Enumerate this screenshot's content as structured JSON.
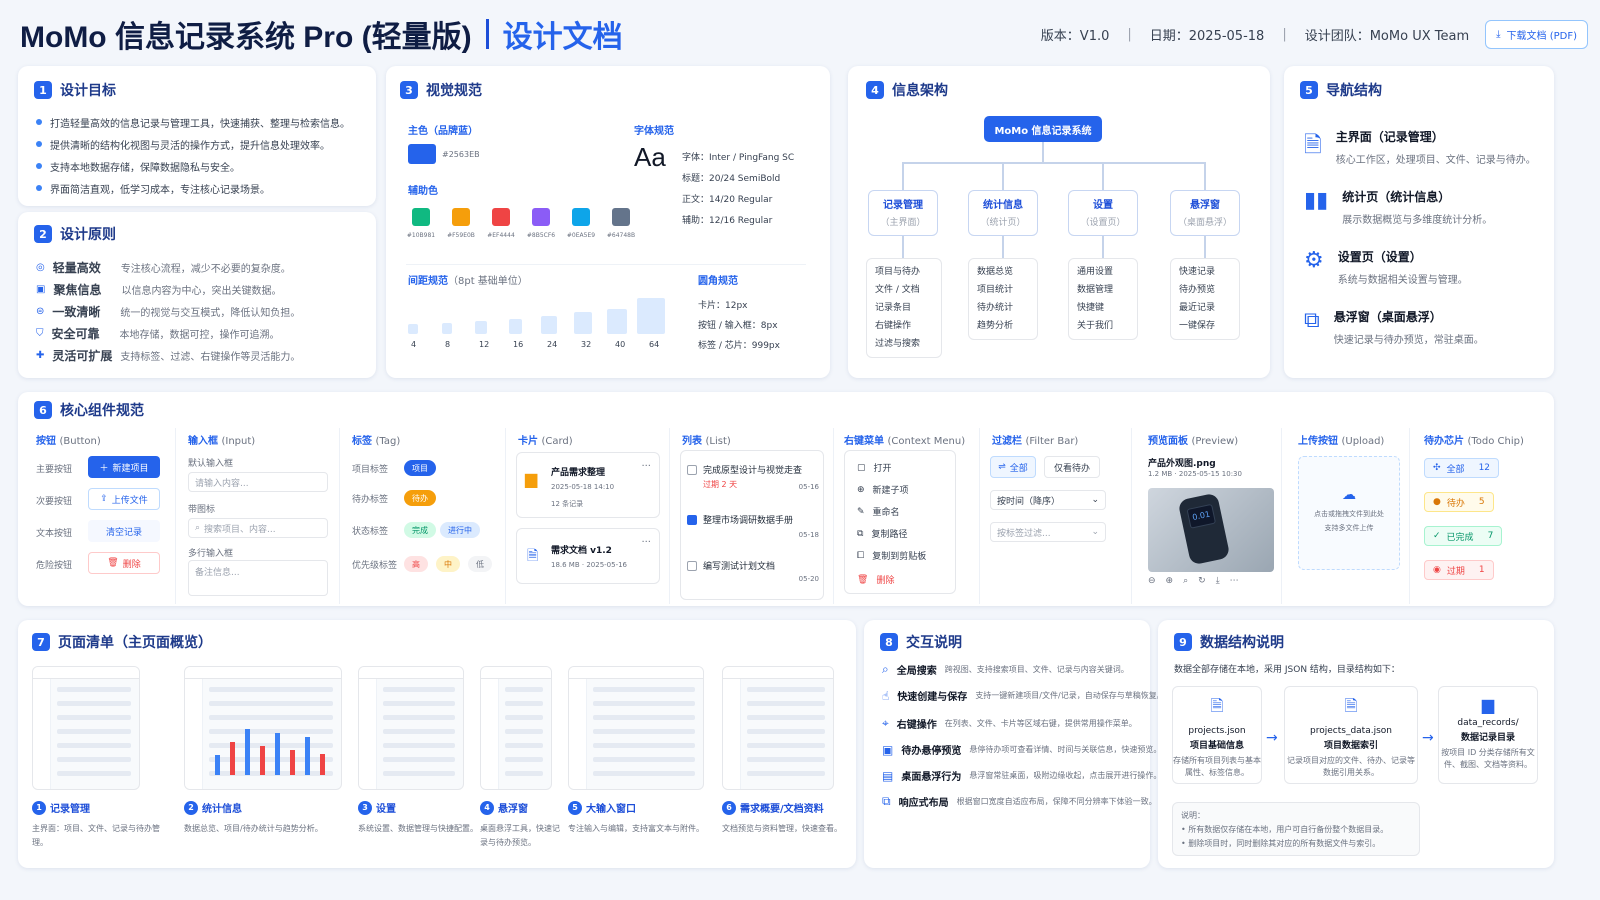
{
  "header": {
    "title": "MoMo 信息记录系统 Pro (轻量版)",
    "subtitle": "设计文档",
    "version": "版本：V1.0",
    "date": "日期：2025-05-18",
    "team": "设计团队：MoMo UX Team",
    "download": "下载文档 (PDF)"
  },
  "goals": {
    "num": "1",
    "title": "设计目标",
    "items": [
      "打造轻量高效的信息记录与管理工具，快速捕获、整理与检索信息。",
      "提供清晰的结构化视图与灵活的操作方式，提升信息处理效率。",
      "支持本地数据存储，保障数据隐私与安全。",
      "界面简洁直观，低学习成本，专注核心记录场景。"
    ]
  },
  "principles": {
    "num": "2",
    "title": "设计原则",
    "items": [
      {
        "name": "轻量高效",
        "desc": "专注核心流程，减少不必要的复杂度。"
      },
      {
        "name": "聚焦信息",
        "desc": "以信息内容为中心，突出关键数据。"
      },
      {
        "name": "一致清晰",
        "desc": "统一的视觉与交互模式，降低认知负担。"
      },
      {
        "name": "安全可靠",
        "desc": "本地存储，数据可控，操作可追溯。"
      },
      {
        "name": "灵活可扩展",
        "desc": "支持标签、过滤、右键操作等灵活能力。"
      }
    ]
  },
  "visual": {
    "num": "3",
    "title": "视觉规范",
    "primary_label": "主色（品牌蓝）",
    "primary_hex": "#2563EB",
    "secondary_label": "辅助色",
    "secondary": [
      {
        "color": "#10B981",
        "hex": "#10B981"
      },
      {
        "color": "#F59E0B",
        "hex": "#F59E0B"
      },
      {
        "color": "#EF4444",
        "hex": "#EF4444"
      },
      {
        "color": "#8B5CF6",
        "hex": "#8B5CF6"
      },
      {
        "color": "#0EA5E9",
        "hex": "#0EA5E9"
      },
      {
        "color": "#64748B",
        "hex": "#64748B"
      }
    ],
    "font_label": "字体规范",
    "font_sample": "Aa",
    "font_lines": [
      "字体：Inter / PingFang SC",
      "标题：20/24 SemiBold",
      "正文：14/20 Regular",
      "辅助：12/16 Regular"
    ],
    "spacing_label": "间距规范",
    "spacing_note": "（8pt 基础单位）",
    "spacing_values": [
      "4",
      "8",
      "12",
      "16",
      "24",
      "32",
      "40",
      "64"
    ],
    "radius_label": "圆角规范",
    "radius_lines": [
      "卡片：12px",
      "按钮 / 输入框：8px",
      "标签 / 芯片：999px"
    ]
  },
  "ia": {
    "num": "4",
    "title": "信息架构",
    "root": "MoMo 信息记录系统",
    "nodes": [
      {
        "name": "记录管理",
        "sub": "（主界面）",
        "items": [
          "项目与待办",
          "文件 / 文档",
          "记录条目",
          "右键操作",
          "过滤与搜索"
        ]
      },
      {
        "name": "统计信息",
        "sub": "（统计页）",
        "items": [
          "数据总览",
          "项目统计",
          "待办统计",
          "趋势分析"
        ]
      },
      {
        "name": "设置",
        "sub": "（设置页）",
        "items": [
          "通用设置",
          "数据管理",
          "快捷键",
          "关于我们"
        ]
      },
      {
        "name": "悬浮窗",
        "sub": "（桌面悬浮）",
        "items": [
          "快速记录",
          "待办预览",
          "最近记录",
          "一键保存"
        ]
      }
    ]
  },
  "nav": {
    "num": "5",
    "title": "导航结构",
    "items": [
      {
        "title": "主界面（记录管理）",
        "desc": "核心工作区，处理项目、文件、记录与待办。"
      },
      {
        "title": "统计页（统计信息）",
        "desc": "展示数据概览与多维度统计分析。"
      },
      {
        "title": "设置页（设置）",
        "desc": "系统与数据相关设置与管理。"
      },
      {
        "title": "悬浮窗（桌面悬浮）",
        "desc": "快速记录与待办预览，常驻桌面。"
      }
    ]
  },
  "components": {
    "num": "6",
    "title": "核心组件规范",
    "button": {
      "title": "按钮",
      "en": "(Button)",
      "rows": [
        "主要按钮",
        "次要按钮",
        "文本按钮",
        "危险按钮"
      ],
      "labels": [
        "新建项目",
        "上传文件",
        "清空记录",
        "删除"
      ]
    },
    "input": {
      "title": "输入框",
      "en": "(Input)",
      "default_label": "默认输入框",
      "default_ph": "请输入内容...",
      "icon_label": "带图标",
      "icon_ph": "搜索项目、内容...",
      "multi_label": "多行输入框",
      "multi_ph": "备注信息..."
    },
    "tag": {
      "title": "标签",
      "en": "(Tag)",
      "rows": [
        "项目标签",
        "待办标签",
        "状态标签",
        "优先级标签"
      ],
      "project": "项目",
      "todo": "待办",
      "done": "完成",
      "doing": "进行中",
      "high": "高",
      "mid": "中",
      "low": "低"
    },
    "card": {
      "title": "卡片",
      "en": "(Card)",
      "c1_title": "产品需求整理",
      "c1_date": "2025-05-18 14:10",
      "c1_count": "12 条记录",
      "c2_title": "需求文档 v1.2",
      "c2_meta": "18.6 MB · 2025-05-16",
      "more": "···"
    },
    "list": {
      "title": "列表",
      "en": "(List)",
      "items": [
        {
          "text": "完成原型设计与视觉走查",
          "note": "过期 2 天",
          "date": "05-16",
          "checked": false
        },
        {
          "text": "整理市场调研数据手册",
          "note": "",
          "date": "05-18",
          "checked": true
        },
        {
          "text": "编写测试计划文档",
          "note": "",
          "date": "05-20",
          "checked": false
        }
      ]
    },
    "menu": {
      "title": "右键菜单",
      "en": "(Context Menu)",
      "items": [
        "打开",
        "新建子项",
        "重命名",
        "复制路径",
        "复制到剪贴板",
        "删除"
      ]
    },
    "filter": {
      "title": "过滤栏",
      "en": "(Filter Bar)",
      "all": "全部",
      "todo_only": "仅看待办",
      "sort": "按时间（降序）",
      "tag_ph": "按标签过滤..."
    },
    "preview": {
      "title": "预览面板",
      "en": "(Preview)",
      "file": "产品外观图.png",
      "meta": "1.2 MB · 2025-05-15 10:30",
      "device_text": "0.01"
    },
    "upload": {
      "title": "上传按钮",
      "en": "(Upload)",
      "line1": "点击或拖拽文件到此处",
      "line2": "支持多文件上传"
    },
    "todo": {
      "title": "待办芯片",
      "en": "(Todo Chip)",
      "chips": [
        {
          "label": "全部",
          "count": "12"
        },
        {
          "label": "待办",
          "count": "5"
        },
        {
          "label": "已完成",
          "count": "7"
        },
        {
          "label": "过期",
          "count": "1"
        }
      ]
    }
  },
  "pages": {
    "num": "7",
    "title": "页面清单（主页面概览）",
    "items": [
      {
        "n": "1",
        "name": "记录管理",
        "desc": "主界面：项目、文件、记录与待办管理。"
      },
      {
        "n": "2",
        "name": "统计信息",
        "desc": "数据总览、项目/待办统计与趋势分析。"
      },
      {
        "n": "3",
        "name": "设置",
        "desc": "系统设置、数据管理与快捷配置。"
      },
      {
        "n": "4",
        "name": "悬浮窗",
        "desc": "桌面悬浮工具，快速记录与待办预览。"
      },
      {
        "n": "5",
        "name": "大输入窗口",
        "desc": "专注输入与编辑，支持富文本与附件。"
      },
      {
        "n": "6",
        "name": "需求概要/文档资料",
        "desc": "文档预览与资料管理，快速查看。"
      }
    ],
    "brand": "MoMo"
  },
  "interaction": {
    "num": "8",
    "title": "交互说明",
    "items": [
      {
        "name": "全局搜索",
        "desc": "跨视图、支持搜索项目、文件、记录与内容关键词。"
      },
      {
        "name": "快速创建与保存",
        "desc": "支持一键新建项目/文件/记录，自动保存与草稿恢复。"
      },
      {
        "name": "右键操作",
        "desc": "在列表、文件、卡片等区域右键，提供常用操作菜单。"
      },
      {
        "name": "待办悬停预览",
        "desc": "悬停待办项可查看详情、时间与关联信息，快速预览。"
      },
      {
        "name": "桌面悬浮行为",
        "desc": "悬浮窗常驻桌面，吸附边缘收起，点击展开进行操作。"
      },
      {
        "name": "响应式布局",
        "desc": "根据窗口宽度自适应布局，保障不同分辨率下体验一致。"
      }
    ]
  },
  "data": {
    "num": "9",
    "title": "数据结构说明",
    "intro": "数据全部存储在本地，采用 JSON 结构，目录结构如下：",
    "boxes": [
      {
        "file": "projects.json",
        "title": "项目基础信息",
        "desc": "存储所有项目列表与基本属性、标签信息。"
      },
      {
        "file": "projects_data.json",
        "title": "项目数据索引",
        "desc": "记录项目对应的文件、待办、记录等数据引用关系。"
      },
      {
        "file": "data_records/",
        "title": "数据记录目录",
        "desc": "按项目 ID 分类存储所有文件、截图、文档等资料。"
      }
    ],
    "note_title": "说明：",
    "notes": [
      "所有数据仅存储在本地，用户可自行备份整个数据目录。",
      "删除项目时，同时删除其对应的所有数据文件与索引。"
    ]
  }
}
